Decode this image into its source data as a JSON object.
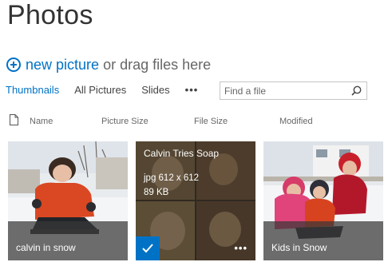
{
  "page": {
    "title": "Photos"
  },
  "upload": {
    "new_label": "new picture",
    "drag_label": "or drag files here",
    "icon": "plus-circle-icon"
  },
  "views": {
    "items": [
      {
        "label": "Thumbnails",
        "active": true
      },
      {
        "label": "All Pictures",
        "active": false
      },
      {
        "label": "Slides",
        "active": false
      }
    ],
    "more": "•••"
  },
  "search": {
    "placeholder": "Find a file",
    "icon": "search-icon"
  },
  "columns": {
    "name": "Name",
    "picture_size": "Picture Size",
    "file_size": "File Size",
    "modified": "Modified"
  },
  "tiles": [
    {
      "caption": "calvin in snow",
      "selected": false
    },
    {
      "title": "Calvin Tries Soap",
      "type_dims": "jpg 612 x 612",
      "file_size": "89 KB",
      "selected": true,
      "more": "•••"
    },
    {
      "caption": "Kids in Snow",
      "selected": false
    }
  ],
  "colors": {
    "accent": "#0072c6",
    "text": "#444444"
  }
}
